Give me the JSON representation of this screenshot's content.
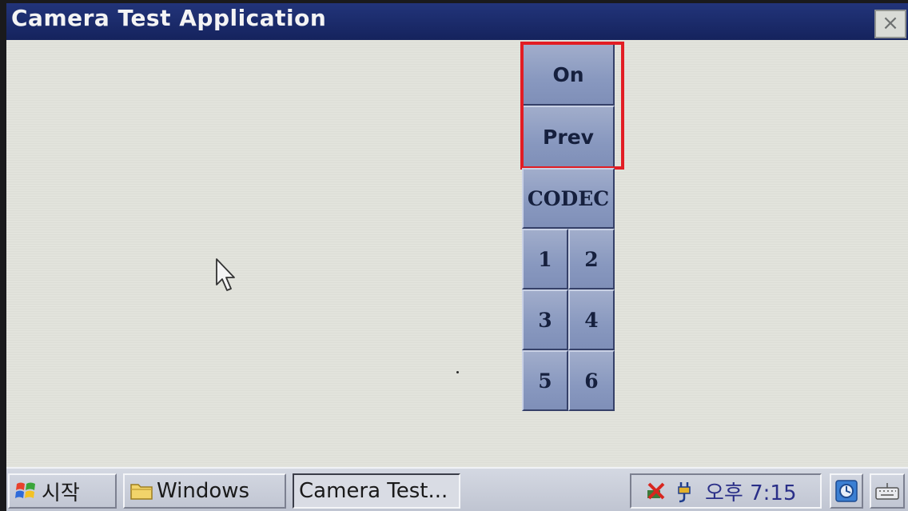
{
  "window": {
    "title": "Camera Test Application",
    "close_glyph": "×"
  },
  "controls": {
    "on_label": "On",
    "prev_label": "Prev",
    "codec_label": "CODEC",
    "number_buttons": [
      "1",
      "2",
      "3",
      "4",
      "5",
      "6"
    ]
  },
  "taskbar": {
    "start_label": "시작",
    "windows_label": "Windows",
    "task_label": "Camera Test...",
    "clock": "오후 7:15",
    "icons": [
      "windows-flag-icon",
      "folder-icon",
      "network-disconnected-icon",
      "power-plug-icon",
      "desktop-icon",
      "keyboard-icon"
    ]
  },
  "colors": {
    "titlebar": "#1b2b6b",
    "button": "#8d9bbf",
    "highlight": "#e21d24"
  }
}
